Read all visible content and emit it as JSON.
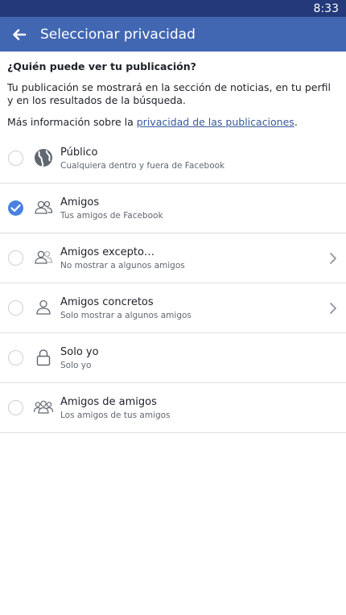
{
  "status_bar": {
    "time": "8:33"
  },
  "header": {
    "title": "Seleccionar privacidad",
    "back_icon": "arrow-left-icon"
  },
  "intro": {
    "question": "¿Quién puede ver tu publicación?",
    "description": "Tu publicación se mostrará en la sección de noticias, en tu perfil y en los resultados de la búsqueda.",
    "more_info_prefix": "Más información sobre la ",
    "more_info_link": "privacidad de las publicaciones",
    "more_info_suffix": "."
  },
  "colors": {
    "status_bar": "#23397a",
    "app_bar": "#4267b2",
    "selected_radio": "#4a80e0",
    "link": "#365899"
  },
  "options": [
    {
      "title": "Público",
      "subtitle": "Cualquiera dentro y fuera de Facebook",
      "icon": "globe-icon",
      "selected": false,
      "has_chevron": false
    },
    {
      "title": "Amigos",
      "subtitle": "Tus amigos de Facebook",
      "icon": "friends-icon",
      "selected": true,
      "has_chevron": false
    },
    {
      "title": "Amigos excepto…",
      "subtitle": "No mostrar a algunos amigos",
      "icon": "friends-except-icon",
      "selected": false,
      "has_chevron": true
    },
    {
      "title": "Amigos concretos",
      "subtitle": "Solo mostrar a algunos amigos",
      "icon": "person-icon",
      "selected": false,
      "has_chevron": true
    },
    {
      "title": "Solo yo",
      "subtitle": "Solo yo",
      "icon": "lock-icon",
      "selected": false,
      "has_chevron": false
    },
    {
      "title": "Amigos de amigos",
      "subtitle": "Los amigos de tus amigos",
      "icon": "friends-of-friends-icon",
      "selected": false,
      "has_chevron": false
    }
  ]
}
